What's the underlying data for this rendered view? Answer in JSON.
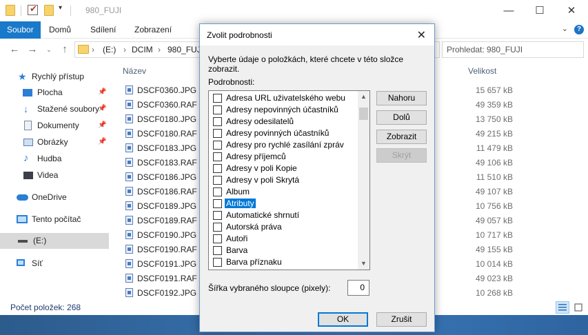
{
  "window": {
    "title": "980_FUJI"
  },
  "ribbon": {
    "tabs": [
      "Soubor",
      "Domů",
      "Sdílení",
      "Zobrazení"
    ]
  },
  "address": {
    "crumbs": [
      "(E:)",
      "DCIM",
      "980_FUJI"
    ],
    "search_placeholder": "Prohledat: 980_FUJI"
  },
  "nav": {
    "items": [
      {
        "label": "Rychlý přístup",
        "icon": "star-icon"
      },
      {
        "label": "Plocha",
        "icon": "desktop-icon"
      },
      {
        "label": "Stažené soubory",
        "icon": "download-icon"
      },
      {
        "label": "Dokumenty",
        "icon": "documents-icon"
      },
      {
        "label": "Obrázky",
        "icon": "pictures-icon"
      },
      {
        "label": "Hudba",
        "icon": "music-icon"
      },
      {
        "label": "Videa",
        "icon": "video-icon"
      },
      {
        "label": "OneDrive",
        "icon": "cloud-icon"
      },
      {
        "label": "Tento počítač",
        "icon": "computer-icon"
      },
      {
        "label": "(E:)",
        "icon": "drive-icon"
      },
      {
        "label": "Síť",
        "icon": "network-icon"
      }
    ]
  },
  "files": {
    "col_name": "Název",
    "col_size": "Velikost",
    "rows": [
      {
        "name": "DSCF0360.JPG",
        "size": "15 657 kB"
      },
      {
        "name": "DSCF0360.RAF",
        "size": "49 359 kB"
      },
      {
        "name": "DSCF0180.JPG",
        "size": "13 750 kB"
      },
      {
        "name": "DSCF0180.RAF",
        "size": "49 215 kB"
      },
      {
        "name": "DSCF0183.JPG",
        "size": "11 479 kB"
      },
      {
        "name": "DSCF0183.RAF",
        "size": "49 106 kB"
      },
      {
        "name": "DSCF0186.JPG",
        "size": "11 510 kB"
      },
      {
        "name": "DSCF0186.RAF",
        "size": "49 107 kB"
      },
      {
        "name": "DSCF0189.JPG",
        "size": "10 756 kB"
      },
      {
        "name": "DSCF0189.RAF",
        "size": "49 057 kB"
      },
      {
        "name": "DSCF0190.JPG",
        "size": "10 717 kB"
      },
      {
        "name": "DSCF0190.RAF",
        "size": "49 155 kB"
      },
      {
        "name": "DSCF0191.JPG",
        "size": "10 014 kB"
      },
      {
        "name": "DSCF0191.RAF",
        "size": "49 023 kB"
      },
      {
        "name": "DSCF0192.JPG",
        "size": "10 268 kB"
      }
    ]
  },
  "status": {
    "count_text": "Počet položek: 268"
  },
  "dialog": {
    "title": "Zvolit podrobnosti",
    "description": "Vyberte údaje o položkách, které chcete v této složce zobrazit.",
    "details_label": "Podrobnosti:",
    "items": [
      {
        "label": "Adresa URL uživatelského webu",
        "checked": false
      },
      {
        "label": "Adresy nepovinných účastníků",
        "checked": false
      },
      {
        "label": "Adresy odesilatelů",
        "checked": false
      },
      {
        "label": "Adresy povinných účastníků",
        "checked": false
      },
      {
        "label": "Adresy pro rychlé zasílání zpráv",
        "checked": false
      },
      {
        "label": "Adresy příjemců",
        "checked": false
      },
      {
        "label": "Adresy v poli Kopie",
        "checked": false
      },
      {
        "label": "Adresy v poli Skrytá",
        "checked": false
      },
      {
        "label": "Album",
        "checked": false
      },
      {
        "label": "Atributy",
        "checked": false,
        "selected": true
      },
      {
        "label": "Automatické shrnutí",
        "checked": false
      },
      {
        "label": "Autorská práva",
        "checked": false
      },
      {
        "label": "Autoři",
        "checked": false
      },
      {
        "label": "Barva",
        "checked": false
      },
      {
        "label": "Barva příznaku",
        "checked": false
      }
    ],
    "buttons": {
      "up": "Nahoru",
      "down": "Dolů",
      "show": "Zobrazit",
      "hide": "Skrýt",
      "ok": "OK",
      "cancel": "Zrušit"
    },
    "width_label": "Šířka vybraného sloupce (pixely):",
    "width_value": "0"
  }
}
